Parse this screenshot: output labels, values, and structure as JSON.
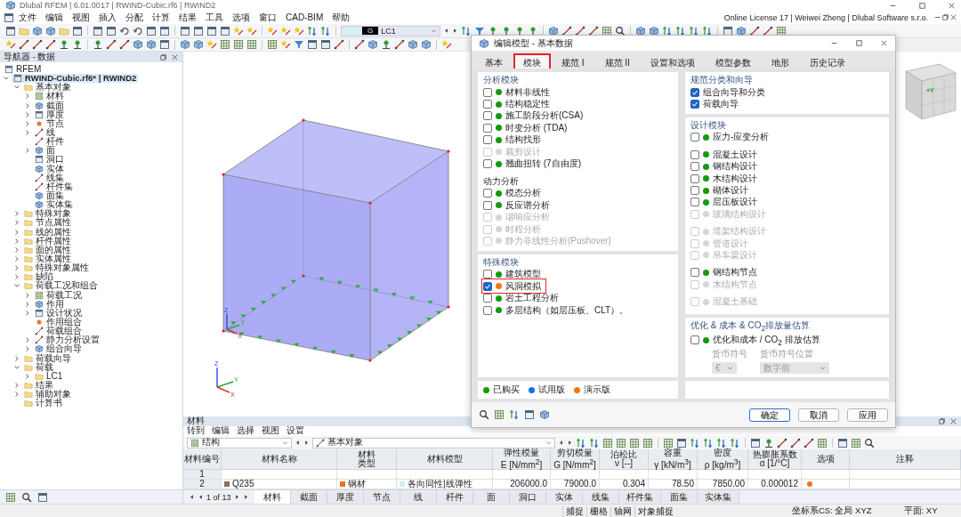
{
  "window": {
    "title": "Dlubal RFEM | 6.01.0017 | RWIND-Cubic.rf6 | RWIND2"
  },
  "menu": [
    "文件",
    "编辑",
    "视图",
    "插入",
    "分配",
    "计算",
    "结果",
    "工具",
    "选项",
    "窗口",
    "CAD-BIM",
    "帮助"
  ],
  "license": "Online License 17 | Weiwei Zheng | Dlubal Software s.r.o.",
  "load_case": {
    "badge": "G",
    "label": "LC1"
  },
  "navigator": {
    "title": "导航器 - 数据",
    "tree": [
      {
        "label": "RFEM",
        "kind": "app",
        "selected": false
      },
      {
        "label": "RWIND-Cubic.rf6* | RWIND2",
        "kind": "model",
        "selected": true,
        "expanded": true,
        "children": [
          {
            "label": "基本对象",
            "kind": "folder",
            "selected": false,
            "expanded": true,
            "children": [
              {
                "label": "材料",
                "kind": "object",
                "selected": false,
                "expanded": false
              },
              {
                "label": "截面",
                "kind": "object",
                "selected": false,
                "expanded": false
              },
              {
                "label": "厚度",
                "kind": "object",
                "selected": false,
                "expanded": false
              },
              {
                "label": "节点",
                "kind": "object",
                "selected": false,
                "expanded": false
              },
              {
                "label": "线",
                "kind": "object",
                "selected": false,
                "expanded": false
              },
              {
                "label": "杆件",
                "kind": "object",
                "selected": false
              },
              {
                "label": "面",
                "kind": "object",
                "selected": false,
                "expanded": false
              },
              {
                "label": "洞口",
                "kind": "object",
                "selected": false
              },
              {
                "label": "实体",
                "kind": "object",
                "selected": false
              },
              {
                "label": "线集",
                "kind": "object",
                "selected": false
              },
              {
                "label": "杆件集",
                "kind": "object",
                "selected": false
              },
              {
                "label": "面集",
                "kind": "object",
                "selected": false
              },
              {
                "label": "实体集",
                "kind": "object",
                "selected": false
              }
            ]
          },
          {
            "label": "特殊对象",
            "kind": "folder",
            "selected": false,
            "expanded": false
          },
          {
            "label": "节点属性",
            "kind": "folder",
            "selected": false,
            "expanded": false
          },
          {
            "label": "线的属性",
            "kind": "folder",
            "selected": false,
            "expanded": false
          },
          {
            "label": "杆件属性",
            "kind": "folder",
            "selected": false,
            "expanded": false
          },
          {
            "label": "面的属性",
            "kind": "folder",
            "selected": false,
            "expanded": false
          },
          {
            "label": "实体属性",
            "kind": "folder",
            "selected": false,
            "expanded": false
          },
          {
            "label": "特殊对象属性",
            "kind": "folder",
            "selected": false,
            "expanded": false
          },
          {
            "label": "缺陷",
            "kind": "folder",
            "selected": false,
            "expanded": false
          },
          {
            "label": "荷载工况和组合",
            "kind": "folder",
            "selected": false,
            "expanded": true,
            "children": [
              {
                "label": "荷载工况",
                "kind": "object",
                "selected": false,
                "expanded": false
              },
              {
                "label": "作用",
                "kind": "object",
                "selected": false,
                "expanded": false
              },
              {
                "label": "设计状况",
                "kind": "object",
                "selected": false,
                "expanded": false
              },
              {
                "label": "作用组合",
                "kind": "object",
                "selected": false
              },
              {
                "label": "荷载组合",
                "kind": "object",
                "selected": false
              },
              {
                "label": "静力分析设置",
                "kind": "object",
                "selected": false,
                "expanded": false
              },
              {
                "label": "组合向导",
                "kind": "object",
                "selected": false,
                "expanded": false
              }
            ]
          },
          {
            "label": "荷载向导",
            "kind": "folder",
            "selected": false,
            "expanded": false
          },
          {
            "label": "荷载",
            "kind": "folder",
            "selected": false,
            "expanded": true,
            "children": [
              {
                "label": "LC1",
                "kind": "folder",
                "selected": false,
                "expanded": false
              }
            ]
          },
          {
            "label": "结果",
            "kind": "folder",
            "selected": false,
            "expanded": false
          },
          {
            "label": "辅助对象",
            "kind": "folder",
            "selected": false,
            "expanded": false
          },
          {
            "label": "计算书",
            "kind": "folder",
            "selected": false
          }
        ]
      }
    ]
  },
  "viewport": {
    "triads": [
      {
        "labels": [
          "Z",
          "Y",
          "X"
        ]
      },
      {
        "labels": [
          "Z",
          "Y",
          "X"
        ]
      }
    ],
    "view_cube": {
      "face_label": "+Y"
    }
  },
  "dialog": {
    "title": "编辑模型 - 基本数据",
    "tabs": [
      {
        "label": "基本",
        "selected": false,
        "highlighted": false
      },
      {
        "label": "模块",
        "selected": true,
        "highlighted": true
      },
      {
        "label": "规范 I",
        "selected": false,
        "highlighted": false
      },
      {
        "label": "规范 II",
        "selected": false,
        "highlighted": false
      },
      {
        "label": "设置和选项",
        "selected": false,
        "highlighted": false
      },
      {
        "label": "模型参数",
        "selected": false,
        "highlighted": false
      },
      {
        "label": "地形",
        "selected": false,
        "highlighted": false
      },
      {
        "label": "历史记录",
        "selected": false,
        "highlighted": false
      }
    ],
    "left_column": [
      {
        "title": "分析模块",
        "groups": [
          {
            "items": [
              {
                "label": "材料非线性",
                "checked": false,
                "disabled": false,
                "color": "#129a12"
              },
              {
                "label": "结构稳定性",
                "checked": false,
                "disabled": false,
                "color": "#129a12"
              },
              {
                "label": "施工阶段分析(CSA)",
                "checked": false,
                "disabled": false,
                "color": "#129a12"
              },
              {
                "label": "时变分析 (TDA)",
                "checked": false,
                "disabled": false,
                "color": "#129a12"
              },
              {
                "label": "结构找形",
                "checked": false,
                "disabled": false,
                "color": "#129a12"
              },
              {
                "label": "裁剪设计",
                "checked": false,
                "disabled": true,
                "color": "#d6d6d6"
              },
              {
                "label": "翘曲扭转 (7自由度)",
                "checked": false,
                "disabled": false,
                "color": "#129a12"
              }
            ]
          },
          {
            "subheading": "动力分析",
            "items": [
              {
                "label": "模态分析",
                "checked": false,
                "disabled": false,
                "color": "#129a12"
              },
              {
                "label": "反应谱分析",
                "checked": false,
                "disabled": false,
                "color": "#129a12"
              },
              {
                "label": "谐响应分析",
                "checked": false,
                "disabled": true,
                "color": "#d6d6d6"
              },
              {
                "label": "时程分析",
                "checked": false,
                "disabled": true,
                "color": "#d6d6d6"
              },
              {
                "label": "静力非线性分析(Pushover)",
                "checked": false,
                "disabled": true,
                "color": "#d6d6d6"
              }
            ]
          }
        ]
      },
      {
        "title": "特殊模块",
        "groups": [
          {
            "items": [
              {
                "label": "建筑模型",
                "checked": false,
                "disabled": false,
                "color": "#129a12",
                "highlighted": false
              },
              {
                "label": "风洞模拟",
                "checked": true,
                "disabled": false,
                "color": "#f07818",
                "highlighted": true
              },
              {
                "label": "岩土工程分析",
                "checked": false,
                "disabled": false,
                "color": "#129a12",
                "highlighted": false
              },
              {
                "label": "多层结构（如层压板、CLT）。",
                "checked": false,
                "disabled": false,
                "color": "#129a12",
                "highlighted": false
              }
            ]
          }
        ]
      }
    ],
    "legend": [
      {
        "label": "已购买",
        "color": "#129a12"
      },
      {
        "label": "试用版",
        "color": "#1a6fe0"
      },
      {
        "label": "演示版",
        "color": "#f07818"
      }
    ],
    "right_column": [
      {
        "title": "规范分类和向导",
        "groups": [
          {
            "items": [
              {
                "label": "组合向导和分类",
                "checked": true,
                "disabled": false
              },
              {
                "label": "荷载向导",
                "checked": true,
                "disabled": false
              }
            ]
          }
        ]
      },
      {
        "title": "设计模块",
        "groups": [
          {
            "items": [
              {
                "label": "应力-应变分析",
                "checked": false,
                "disabled": false,
                "color": "#129a12"
              }
            ]
          },
          {
            "items": [
              {
                "label": "混凝土设计",
                "checked": false,
                "disabled": false,
                "color": "#129a12"
              },
              {
                "label": "钢结构设计",
                "checked": false,
                "disabled": false,
                "color": "#129a12"
              },
              {
                "label": "木结构设计",
                "checked": false,
                "disabled": false,
                "color": "#129a12"
              },
              {
                "label": "砌体设计",
                "checked": false,
                "disabled": false,
                "color": "#129a12"
              },
              {
                "label": "层压板设计",
                "checked": false,
                "disabled": false,
                "color": "#129a12"
              },
              {
                "label": "玻璃结构设计",
                "checked": false,
                "disabled": true,
                "color": "#d6d6d6"
              }
            ]
          },
          {
            "items": [
              {
                "label": "塔架结构设计",
                "checked": false,
                "disabled": true,
                "color": "#d6d6d6"
              },
              {
                "label": "管道设计",
                "checked": false,
                "disabled": true,
                "color": "#d6d6d6"
              },
              {
                "label": "吊车梁设计",
                "checked": false,
                "disabled": true,
                "color": "#d6d6d6"
              }
            ]
          },
          {
            "items": [
              {
                "label": "钢结构节点",
                "checked": false,
                "disabled": false,
                "color": "#129a12"
              },
              {
                "label": "木结构节点",
                "checked": false,
                "disabled": true,
                "color": "#d6d6d6"
              }
            ]
          },
          {
            "items": [
              {
                "label": "混凝土基础",
                "checked": false,
                "disabled": true,
                "color": "#d6d6d6"
              }
            ]
          }
        ]
      },
      {
        "title": "优化 & 成本 & CO$_{2}$排放量估算",
        "groups": [
          {
            "items": [
              {
                "label": "优化和成本 / CO$_{2}$ 排放估算",
                "checked": false,
                "disabled": false,
                "color": "#129a12"
              }
            ]
          }
        ],
        "fields": [
          {
            "label": "货币符号",
            "value": "€",
            "disabled": true
          },
          {
            "label": "货币符号位置",
            "value": "数字前",
            "disabled": true
          }
        ]
      }
    ],
    "buttons": [
      {
        "label": "确定",
        "default": true
      },
      {
        "label": "取消",
        "default": false
      },
      {
        "label": "应用",
        "default": false
      }
    ]
  },
  "materials_panel": {
    "title": "材料",
    "menu": [
      "转到",
      "编辑",
      "选择",
      "视图",
      "设置"
    ],
    "filters": [
      {
        "value": "结构"
      },
      {
        "value": "基本对象"
      }
    ],
    "table": {
      "columns": [
        "材料编号",
        "材料名称",
        "材料类型",
        "材料模型",
        "弹性模量\nE [N/mm$^{2}$]",
        "剪切模量\nG [N/mm$^{2}$]",
        "泊松比\nν [--]",
        "容重\nγ [kN/m$^{3}$]",
        "密度\nρ [kg/m$^{3}$]",
        "热膨胀系数\nα [1/°C]",
        "选项",
        "注释"
      ],
      "rows": [
        {
          "cells": [
            {
              "text": "1"
            }
          ]
        },
        {
          "cells": [
            {
              "text": "2"
            },
            {
              "text": "Q235",
              "color": "#8a7460"
            },
            {
              "text": "钢材",
              "color": "#e8742a"
            },
            {
              "text": "各向同性|线弹性",
              "color": "#cdf3f7"
            },
            {
              "text": "206000.0"
            },
            {
              "text": "79000.0"
            },
            {
              "text": "0.304"
            },
            {
              "text": "78.50"
            },
            {
              "text": "7850.00"
            },
            {
              "text": "0.000012"
            },
            {
              "kind": "options"
            }
          ]
        }
      ]
    },
    "pager": "1 of 13",
    "tabs": [
      {
        "label": "材料",
        "selected": true
      },
      {
        "label": "截面",
        "selected": false
      },
      {
        "label": "厚度",
        "selected": false
      },
      {
        "label": "节点",
        "selected": false
      },
      {
        "label": "线",
        "selected": false
      },
      {
        "label": "杆件",
        "selected": false
      },
      {
        "label": "面",
        "selected": false
      },
      {
        "label": "洞口",
        "selected": false
      },
      {
        "label": "实体",
        "selected": false
      },
      {
        "label": "线集",
        "selected": false
      },
      {
        "label": "杆件集",
        "selected": false
      },
      {
        "label": "面集",
        "selected": false
      },
      {
        "label": "实体集",
        "selected": false
      }
    ]
  },
  "status_bar": {
    "toggles": [
      "捕捉",
      "栅格",
      "轴网",
      "对象捕捉"
    ],
    "coordinate_system": "坐标系CS: 全局 XYZ",
    "plane": "平面: XY"
  }
}
